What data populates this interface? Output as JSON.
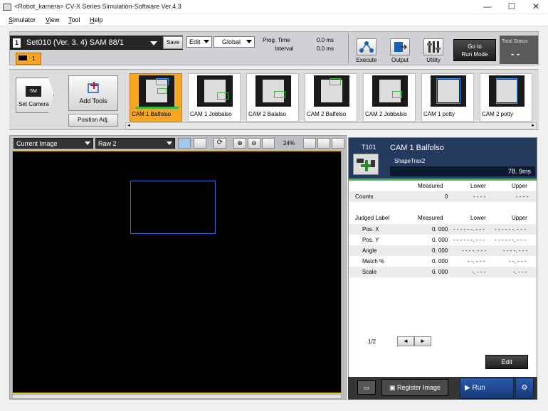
{
  "window": {
    "title": "<Robot_kamera> CV-X Series Simulation-Software Ver.4.3",
    "minimize": "—",
    "maximize": "☐",
    "close": "✕"
  },
  "menu": [
    "Simulator",
    "View",
    "Tool",
    "Help"
  ],
  "toolbar": {
    "set_number": "1",
    "set_label": "Set010  (Ver. 3. 4)  SAM  88/1",
    "save_label": "Save",
    "edit_select": "Edit",
    "scope_select": "Global",
    "prog_time_label": "Prog.  Time",
    "prog_time_value": "0.0  ms",
    "interval_label": "Interval",
    "interval_value": "0.0  ms",
    "execute_label": "Execute",
    "output_label": "Output",
    "utility_label": "Utility",
    "goto_run_line1": "Go to",
    "goto_run_line2": "Run Mode",
    "total_status_label": "Total Status",
    "total_status_value": "- -",
    "tab1_label": "1"
  },
  "tools_row": {
    "camera_badge": "5M",
    "set_camera_label": "Set Camera",
    "add_tools_label": "Add Tools",
    "position_adj_label": "Position Adj.",
    "thumbnails": [
      {
        "label": "CAM  1  Balfolso",
        "selected": true
      },
      {
        "label": "CAM  1  Jobbalso",
        "selected": false
      },
      {
        "label": "CAM  2  Balalso",
        "selected": false
      },
      {
        "label": "CAM  2  Balfelso",
        "selected": false
      },
      {
        "label": "CAM  2  Jobbalso",
        "selected": false
      },
      {
        "label": "CAM  1  potty",
        "selected": false
      },
      {
        "label": "CAM  2  potty",
        "selected": false
      }
    ]
  },
  "viewer": {
    "image_select": "Current Image",
    "raw_select": "Raw  2",
    "zoom_label": "24%"
  },
  "detail": {
    "tool_id": "T101",
    "tool_name": "CAM  1  Balfolso",
    "tool_type": "ShapeTrax2",
    "time": "78. 9ms",
    "col_measured": "Measured",
    "col_lower": "Lower",
    "col_upper": "Upper",
    "counts_label": "Counts",
    "counts_measured": "0",
    "counts_lower": "- - - -",
    "counts_upper": "- - - -",
    "judged_label": "Judged  Label",
    "rows": [
      {
        "label": "Pos.  X",
        "measured": "0. 000",
        "lower": "- - - - - -. - - -",
        "upper": "- - - - - -. - - -"
      },
      {
        "label": "Pos.  Y",
        "measured": "0. 000",
        "lower": "- - - - - -. - - -",
        "upper": "- - - - - -. - - -"
      },
      {
        "label": "Angle",
        "measured": "0. 000",
        "lower": "- - - -. - - -",
        "upper": "- - - -. - - -"
      },
      {
        "label": "Match  %",
        "measured": "0. 000",
        "lower": "- -. - - -",
        "upper": "- -. - - -"
      },
      {
        "label": "Scale",
        "measured": "0. 000",
        "lower": "-. - - -",
        "upper": "-. - - -"
      }
    ],
    "page": "1/2",
    "prev": "◄",
    "next": "►",
    "edit_label": "Edit"
  },
  "bottom": {
    "register_image_label": "Register  Image",
    "run_label": "Run"
  },
  "colors": {
    "accent_orange": "#f6a623",
    "header_navy": "#243a5f",
    "roi_blue": "#2d6fd2",
    "progress_green": "#3db846"
  }
}
